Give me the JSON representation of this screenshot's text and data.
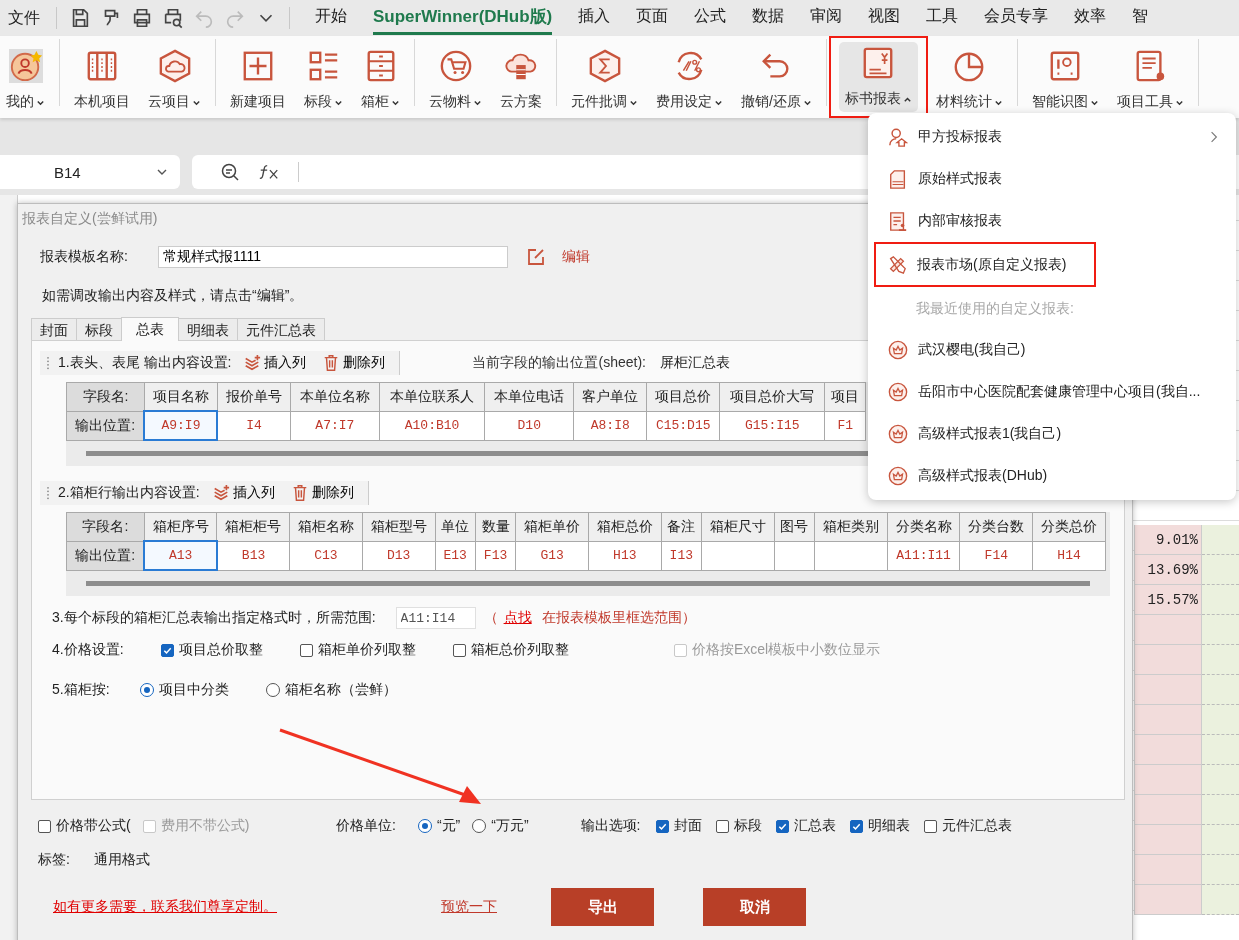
{
  "tab_bar": {
    "file_menu": "文件",
    "quick_access": [
      {
        "kind": "save",
        "disabled": false
      },
      {
        "kind": "painter",
        "disabled": false
      },
      {
        "kind": "print",
        "disabled": false
      },
      {
        "kind": "preview",
        "disabled": false
      },
      {
        "kind": "undo",
        "disabled": true
      },
      {
        "kind": "redo",
        "disabled": true
      },
      {
        "kind": "more",
        "disabled": false
      }
    ],
    "tabs": [
      {
        "label": "开始",
        "selected": false
      },
      {
        "label": "SuperWinner(DHub版)",
        "selected": true
      },
      {
        "label": "插入",
        "selected": false
      },
      {
        "label": "页面",
        "selected": false
      },
      {
        "label": "公式",
        "selected": false
      },
      {
        "label": "数据",
        "selected": false
      },
      {
        "label": "审阅",
        "selected": false
      },
      {
        "label": "视图",
        "selected": false
      },
      {
        "label": "工具",
        "selected": false
      },
      {
        "label": "会员专享",
        "selected": false
      },
      {
        "label": "效率",
        "selected": false
      },
      {
        "label": "智",
        "selected": false
      }
    ]
  },
  "ribbon": {
    "groups": [
      {
        "buttons": [
          {
            "label": "我的",
            "kind": "user",
            "has_menu": true,
            "expanded": false,
            "marked": false
          }
        ]
      },
      {
        "buttons": [
          {
            "label": "本机项目",
            "kind": "racks",
            "has_menu": false,
            "expanded": false,
            "marked": false
          },
          {
            "label": "云项目",
            "kind": "cloud-box",
            "has_menu": true,
            "expanded": false,
            "marked": false
          }
        ]
      },
      {
        "buttons": [
          {
            "label": "新建项目",
            "kind": "plus",
            "has_menu": false,
            "expanded": false,
            "marked": false
          },
          {
            "label": "标段",
            "kind": "list",
            "has_menu": true,
            "expanded": false,
            "marked": false
          },
          {
            "label": "箱柜",
            "kind": "cabinet",
            "has_menu": true,
            "expanded": false,
            "marked": false
          }
        ]
      },
      {
        "buttons": [
          {
            "label": "云物料",
            "kind": "cart",
            "has_menu": true,
            "expanded": false,
            "marked": false
          },
          {
            "label": "云方案",
            "kind": "cloud-server",
            "has_menu": false,
            "expanded": false,
            "marked": false
          }
        ]
      },
      {
        "buttons": [
          {
            "label": "元件批调",
            "kind": "sigma",
            "has_menu": true,
            "expanded": false,
            "marked": false
          },
          {
            "label": "费用设定",
            "kind": "percent",
            "has_menu": true,
            "expanded": false,
            "marked": false
          },
          {
            "label": "撤销/还原",
            "kind": "undo",
            "has_menu": true,
            "expanded": false,
            "marked": false
          }
        ]
      },
      {
        "buttons": [
          {
            "label": "标书报表",
            "kind": "report",
            "has_menu": true,
            "expanded": true,
            "marked": true
          },
          {
            "label": "材料统计",
            "kind": "pie",
            "has_menu": true,
            "expanded": false,
            "marked": false
          }
        ]
      },
      {
        "buttons": [
          {
            "label": "智能识图",
            "kind": "scan",
            "has_menu": true,
            "expanded": false,
            "marked": false
          },
          {
            "label": "项目工具",
            "kind": "tool-list",
            "has_menu": true,
            "expanded": false,
            "marked": false
          }
        ]
      }
    ]
  },
  "formula_bar": {
    "cell_ref": "B14"
  },
  "sheet": {
    "cells": [
      {
        "value": "9.01%"
      },
      {
        "value": "13.69%"
      },
      {
        "value": "15.57%"
      }
    ]
  },
  "dialog": {
    "title": "报表自定义(尝鲜试用)",
    "template_label": "报表模板名称:",
    "template_name": "常规样式报1111",
    "edit_link": "编辑",
    "hint": "如需调改输出内容及样式，请点击“编辑”。",
    "tabs": [
      {
        "label": "封面",
        "selected": false
      },
      {
        "label": "标段",
        "selected": false
      },
      {
        "label": "总表",
        "selected": true
      },
      {
        "label": "明细表",
        "selected": false
      },
      {
        "label": "元件汇总表",
        "selected": false
      }
    ],
    "section1": {
      "title": "1.表头、表尾 输出内容设置:",
      "insert": "插入列",
      "delete": "删除列",
      "sheet_label": "当前字段的输出位置(sheet):",
      "sheet_name": "屏柜汇总表",
      "row_labels": [
        "字段名:",
        "输出位置:"
      ],
      "columns": [
        {
          "field": "项目名称",
          "position": "A9:I9",
          "selected": true
        },
        {
          "field": "报价单号",
          "position": "I4",
          "selected": false
        },
        {
          "field": "本单位名称",
          "position": "A7:I7",
          "selected": false
        },
        {
          "field": "本单位联系人",
          "position": "A10:B10",
          "selected": false
        },
        {
          "field": "本单位电话",
          "position": "D10",
          "selected": false
        },
        {
          "field": "客户单位",
          "position": "A8:I8",
          "selected": false
        },
        {
          "field": "项目总价",
          "position": "C15:D15",
          "selected": false
        },
        {
          "field": "项目总价大写",
          "position": "G15:I15",
          "selected": false
        },
        {
          "field": "项目",
          "position": "F1",
          "selected": false
        }
      ]
    },
    "section2": {
      "title": "2.箱柜行输出内容设置:",
      "insert": "插入列",
      "delete": "删除列",
      "row_labels": [
        "字段名:",
        "输出位置:"
      ],
      "columns": [
        {
          "field": "箱柜序号",
          "position": "A13",
          "selected": true
        },
        {
          "field": "箱柜柜号",
          "position": "B13",
          "selected": false
        },
        {
          "field": "箱柜名称",
          "position": "C13",
          "selected": false
        },
        {
          "field": "箱柜型号",
          "position": "D13",
          "selected": false
        },
        {
          "field": "单位",
          "position": "E13",
          "selected": false
        },
        {
          "field": "数量",
          "position": "F13",
          "selected": false
        },
        {
          "field": "箱柜单价",
          "position": "G13",
          "selected": false
        },
        {
          "field": "箱柜总价",
          "position": "H13",
          "selected": false
        },
        {
          "field": "备注",
          "position": "I13",
          "selected": false
        },
        {
          "field": "箱柜尺寸",
          "selected": false
        },
        {
          "field": "图号",
          "selected": false
        },
        {
          "field": "箱柜类别",
          "selected": false
        },
        {
          "field": "分类名称",
          "position": "A11:I11",
          "selected": false
        },
        {
          "field": "分类台数",
          "position": "F14",
          "selected": false
        },
        {
          "field": "分类总价",
          "position": "H14",
          "selected": false
        }
      ]
    },
    "section3": {
      "label": "3.每个标段的箱柜汇总表输出指定格式时，所需范围:",
      "range": "A11:I14",
      "hint_open": "（",
      "link": "点找",
      "hint_rest": "在报表模板里框选范围）"
    },
    "section4": {
      "label": "4.价格设置:",
      "options": [
        {
          "label": "项目总价取整",
          "checked": true,
          "disabled": false
        },
        {
          "label": "箱柜单价列取整",
          "checked": false,
          "disabled": false
        },
        {
          "label": "箱柜总价列取整",
          "checked": false,
          "disabled": false
        },
        {
          "label": "价格按Excel模板中小数位显示",
          "checked": false,
          "disabled": true
        }
      ]
    },
    "section5": {
      "label": "5.箱柜按:",
      "options": [
        {
          "label": "项目中分类",
          "selected": true
        },
        {
          "label": "箱柜名称（尝鲜）",
          "selected": false
        }
      ]
    },
    "formula_options": [
      {
        "label": "价格带公式(",
        "checked": false,
        "disabled": false
      },
      {
        "label": "费用不带公式)",
        "checked": false,
        "disabled": true
      }
    ],
    "unit_label": "价格单位:",
    "units": [
      {
        "label": "“元”",
        "selected": true
      },
      {
        "label": "“万元”",
        "selected": false
      }
    ],
    "output_label": "输出选项:",
    "outputs": [
      {
        "label": "封面",
        "checked": true
      },
      {
        "label": "标段",
        "checked": false
      },
      {
        "label": "汇总表",
        "checked": true
      },
      {
        "label": "明细表",
        "checked": true
      },
      {
        "label": "元件汇总表",
        "checked": false
      }
    ],
    "tag_label": "标签:",
    "tag_value": "通用格式",
    "contact_link": "如有更多需要，联系我们尊享定制。",
    "preview_link": "预览一下",
    "buttons": [
      "导出",
      "取消"
    ]
  },
  "dropdown": {
    "items": [
      {
        "kind": "person",
        "label": "甲方投标报表",
        "submenu": true,
        "marked": false
      },
      {
        "kind": "doc-number",
        "label": "原始样式报表",
        "submenu": false,
        "marked": false
      },
      {
        "kind": "audit",
        "label": "内部审核报表",
        "submenu": false,
        "marked": false
      },
      {
        "kind": "tools",
        "label": "报表市场(原自定义报表)",
        "submenu": false,
        "marked": true
      }
    ],
    "recent_heading": "我最近使用的自定义报表:",
    "recent": [
      {
        "label": "武汉樱电(我自己)"
      },
      {
        "label": "岳阳市中心医院配套健康管理中心项目(我自..."
      },
      {
        "label": "高级样式报表1(我自己)"
      },
      {
        "label": "高级样式报表(DHub)"
      }
    ]
  },
  "annotations": [
    {
      "kind": "arrow"
    }
  ]
}
